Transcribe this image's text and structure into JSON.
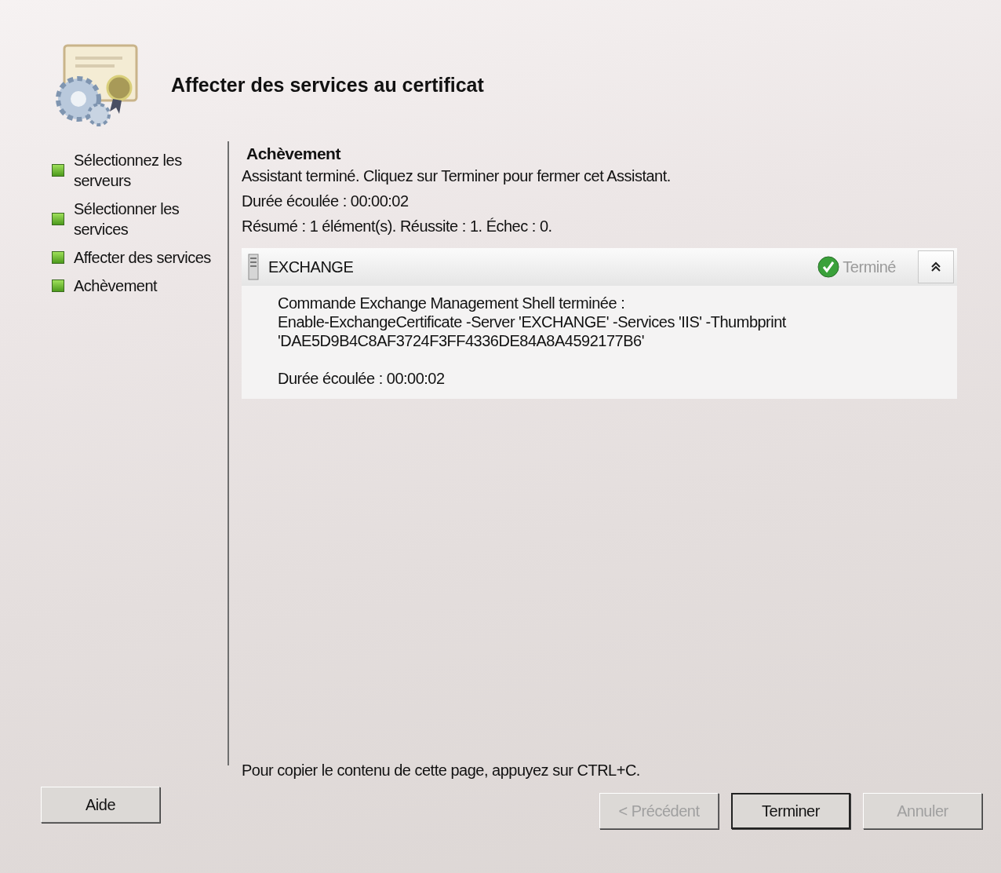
{
  "header": {
    "title": "Affecter des services au certificat"
  },
  "steps": [
    {
      "label": "Sélectionnez les serveurs"
    },
    {
      "label": "Sélectionner les services"
    },
    {
      "label": "Affecter des services"
    },
    {
      "label": "Achèvement"
    }
  ],
  "page": {
    "heading": "Achèvement",
    "message": "Assistant terminé. Cliquez sur Terminer pour fermer cet Assistant.",
    "elapsed": "Durée écoulée : 00:00:02",
    "summary": "Résumé : 1 élément(s). Réussite : 1. Échec : 0."
  },
  "results": [
    {
      "name": "EXCHANGE",
      "status": "Terminé",
      "expanded": true,
      "lines": [
        "Commande Exchange Management Shell terminée :",
        "Enable-ExchangeCertificate -Server 'EXCHANGE' -Services 'IIS' -Thumbprint 'DAE5D9B4C8AF3724F3FF4336DE84A8A4592177B6'"
      ],
      "elapsed": "Durée écoulée : 00:00:02"
    }
  ],
  "copy_hint": "Pour copier le contenu de cette page, appuyez sur CTRL+C.",
  "buttons": [
    {
      "kind": "help",
      "label": "Aide",
      "disabled": false,
      "default": false
    },
    {
      "kind": "nav",
      "label": "< Précédent",
      "disabled": true,
      "default": false
    },
    {
      "kind": "nav",
      "label": "Terminer",
      "disabled": false,
      "default": true
    },
    {
      "kind": "nav",
      "label": "Annuler",
      "disabled": true,
      "default": false
    }
  ]
}
